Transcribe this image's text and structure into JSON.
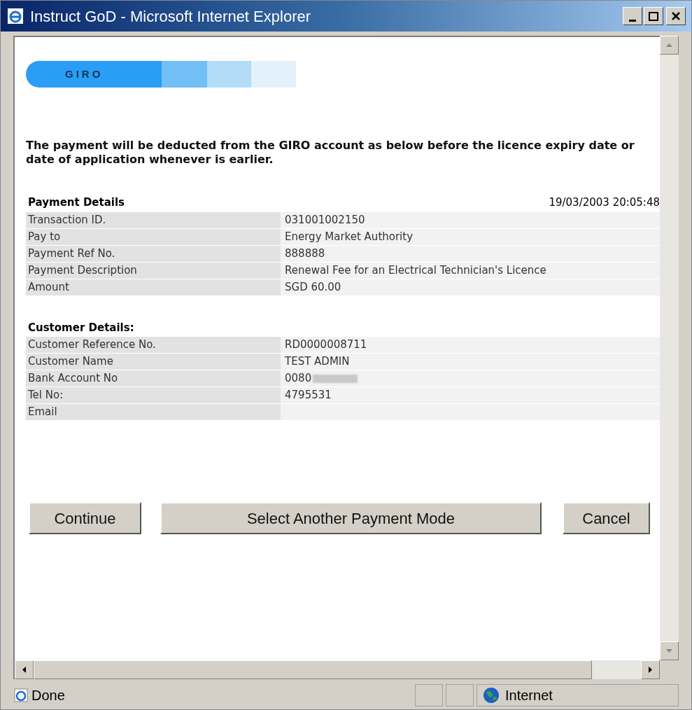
{
  "window": {
    "title": "Instruct GoD - Microsoft Internet Explorer"
  },
  "banner": {
    "label": "GIRO"
  },
  "notice": "The payment will be deducted from the GIRO account as below before the licence expiry date or date of application whenever is earlier.",
  "payment_details": {
    "heading": "Payment Details",
    "timestamp": "19/03/2003 20:05:48",
    "rows": [
      {
        "label": "Transaction ID.",
        "value": "031001002150"
      },
      {
        "label": "Pay to",
        "value": "Energy Market Authority"
      },
      {
        "label": "Payment Ref No.",
        "value": "888888"
      },
      {
        "label": "Payment Description",
        "value": "Renewal Fee for an Electrical Technician's Licence"
      },
      {
        "label": "Amount",
        "value": "SGD 60.00"
      }
    ]
  },
  "customer_details": {
    "heading": "Customer Details:",
    "rows": [
      {
        "label": "Customer Reference No.",
        "value": "RD0000008711"
      },
      {
        "label": "Customer Name",
        "value": "TEST ADMIN"
      },
      {
        "label": "Bank Account No",
        "value": "0080",
        "redacted": true
      },
      {
        "label": "Tel No:",
        "value": "4795531"
      },
      {
        "label": "Email"
      }
    ]
  },
  "buttons": [
    "Continue",
    "Select Another Payment Mode",
    "Cancel"
  ],
  "status_bar": {
    "text": "Done",
    "zone": "Internet"
  }
}
